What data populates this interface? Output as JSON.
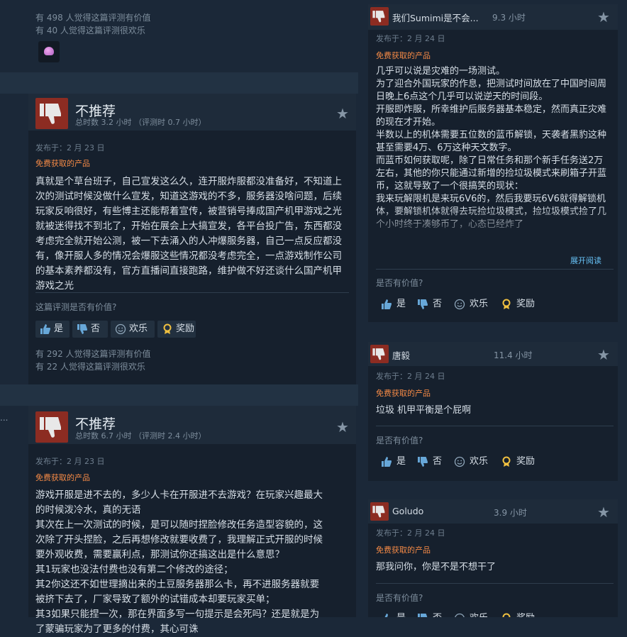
{
  "review_top": {
    "helpful_count_text": "有 498 人觉得这篇评测有价值",
    "funny_count_text": "有 40 人觉得这篇评测很欢乐"
  },
  "review1": {
    "verdict": "不推荐",
    "hours": "总时数 3.2 小时 （评测时 0.7 小时）",
    "posted": "发布于：2 月 23 日",
    "free_label": "免费获取的产品",
    "text": "真就是个草台班子，自己宣发这么久，连开服炸服都没准备好，不知道上次的测试时候没做什么宣发，知道这游戏的不多，服务器没啥问题，后续玩家反响很好，有些博主还能帮着宣传，被营销号捧成国产机甲游戏之光就被迷得找不到北了，开始在展会上大搞宣发，各平台投广告，东西都没考虑完全就开始公测，被一下去涌入的人冲爆服务器，自己一点反应都没有，像开服人多的情况会爆服这些情况都没考虑完全，一点游戏制作公司的基本素养都没有，官方直播间直接跑路，维护做不好还谈什么国产机甲游戏之光",
    "question": "这篇评测是否有价值?",
    "yes": "是",
    "no": "否",
    "funny": "欢乐",
    "award": "奖励",
    "helpful_count_text": "有 292 人觉得这篇评测有价值",
    "funny_count_text": "有 22 人觉得这篇评测很欢乐"
  },
  "review2": {
    "verdict": "不推荐",
    "hours": "总时数 6.7 小时 （评测时 2.4 小时）",
    "posted": "发布于：2 月 23 日",
    "free_label": "免费获取的产品",
    "lines": [
      "游戏开服是进不去的，多少人卡在开服进不去游戏？在玩家兴趣最大",
      "的时候泼冷水，真的无语",
      "其次在上一次测试的时候，是可以随时捏脸修改任务造型容貌的，这",
      "次除了开头捏脸，之后再想修改就要收费了，我理解正式开服的时候",
      "要外观收费，需要赢利点，那测试你还搞这出是什么意思？",
      "其1玩家也没法付费也没有第二个修改的途径；",
      "其2你这还不如世理摘出来的土豆服务器那么卡，再不进服务器就要",
      "被挤下去了，厂家导致了额外的试错成本却要玩家买单；",
      "其3如果只能捏一次，那在界面多写一句提示是会死吗？还是就是为",
      "了蒙骗玩家为了更多的付费，其心可诛"
    ]
  },
  "right1": {
    "user": "我们Sumimi是不会...",
    "hours": "9.3 小时",
    "posted": "发布于：2 月 24 日",
    "free_label": "免费获取的产品",
    "text": "几乎可以说是灾难的一场测试。\n为了迎合外国玩家的作息，把测试时间放在了中国时间周日晚上6点这个几乎可以说逆天的时间段。\n开服即炸服，所幸维护后服务器基本稳定，然而真正灾难的现在才开始。\n半数以上的机体需要五位数的蓝币解锁，天袭者黑豹这种甚至需要4万、6万这种天文数字。\n而蓝币如何获取呢，除了日常任务和那个新手任务送2万左右，其他的你只能通过新增的捡垃圾模式来刷箱子开蓝币，这就导致了一个很搞笑的现状：\n我来玩解限机是来玩6V6的，然后我要玩6V6就得解锁机体，要解锁机体就得去玩捡垃圾模式，捡垃圾模式捡了几个小时终于凑够币了，心态已经炸了",
    "expand": "展开阅读",
    "question": "是否有价值?",
    "yes": "是",
    "no": "否",
    "funny": "欢乐",
    "award": "奖励"
  },
  "right2": {
    "user": "唐毅",
    "hours": "11.4 小时",
    "posted": "发布于：2 月 24 日",
    "free_label": "免费获取的产品",
    "text": "垃圾 机甲平衡是个屁啊",
    "question": "是否有价值?",
    "yes": "是",
    "no": "否",
    "funny": "欢乐",
    "award": "奖励"
  },
  "right3": {
    "user": "Goludo",
    "hours": "3.9 小时",
    "posted": "发布于：2 月 24 日",
    "free_label": "免费获取的产品",
    "text": "那我问你，你是不是不想干了",
    "question": "是否有价值?",
    "yes": "是",
    "no": "否",
    "funny": "欢乐",
    "award": "奖励"
  },
  "misc": {
    "ellipsis": "..."
  },
  "colors": {
    "background": "#1b2838",
    "card": "#16202d",
    "thumb_red": "#8c2c22",
    "free_orange": "#f58a46",
    "link_blue": "#66c0f4",
    "award_gold": "#f0c040"
  }
}
